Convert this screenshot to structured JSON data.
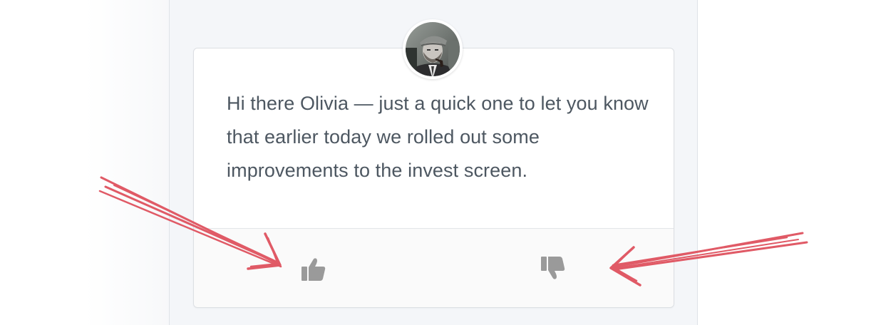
{
  "message": {
    "text": "Hi there Olivia — just a quick one to let you know that earlier today we rolled out some improvements to the invest screen."
  },
  "avatar": {
    "icon": "user-avatar-photo"
  },
  "feedback": {
    "up_icon": "thumbs-up-icon",
    "down_icon": "thumbs-down-icon"
  },
  "colors": {
    "text": "#4d5761",
    "icon": "#9a9a9a",
    "annotation_arrow": "#e05a66",
    "panel_bg": "#f4f6f9",
    "card_bg": "#ffffff",
    "footer_bg": "#fafafa"
  }
}
